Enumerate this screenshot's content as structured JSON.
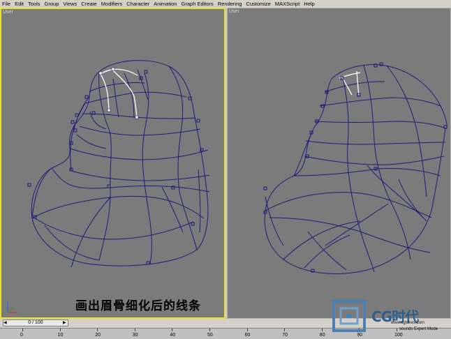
{
  "menu": [
    "File",
    "Edit",
    "Tools",
    "Group",
    "Views",
    "Create",
    "Modifiers",
    "Character",
    "Animation",
    "Graph Editors",
    "Rendering",
    "Customize",
    "MAXScript",
    "Help"
  ],
  "viewports": {
    "left_label": "User",
    "right_label": "User"
  },
  "caption": "画出眉骨细化后的线条",
  "timeline": {
    "slider_text": "0 / 100",
    "ticks": [
      "0",
      "10",
      "20",
      "30",
      "40",
      "50",
      "60",
      "70",
      "80",
      "90",
      "100"
    ]
  },
  "logo": {
    "name": "CG时代",
    "url": "www.cgtimes.com"
  },
  "status": {
    "right_text": "sounds Expert Mode"
  },
  "colors": {
    "active_border": "#e8e030",
    "wire": "#1e1e7a",
    "viewport_bg": "#7b7b7b",
    "highlight": "#ffffff"
  }
}
